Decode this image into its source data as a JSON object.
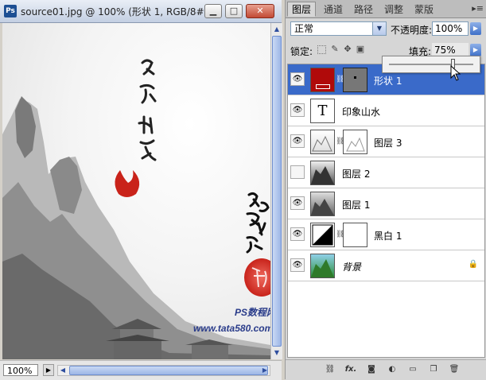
{
  "document": {
    "title": "source01.jpg @ 100% (形状 1, RGB/8#...",
    "app_icon": "Ps",
    "zoom": "100%",
    "canvas": {
      "watermark_line1": "PS数程网",
      "watermark_line2": "www.tata580.com"
    }
  },
  "window_buttons": {
    "minimize": "▁",
    "maximize": "□",
    "close": "✕"
  },
  "panel": {
    "tabs": [
      "图层",
      "通道",
      "路径",
      "调整",
      "蒙版"
    ],
    "active_tab": 0,
    "menu_glyph": "▸≡",
    "blend_mode": "正常",
    "opacity_label": "不透明度:",
    "opacity_value": "100%",
    "lock_label": "锁定:",
    "fill_label": "填充:",
    "fill_value": "75%",
    "fill_level_percent": 75,
    "layers": [
      {
        "name": "形状 1",
        "visible": true,
        "selected": true,
        "type": "shape",
        "thumb_color": "#b00a0a",
        "mask": true
      },
      {
        "name": "印象山水",
        "visible": true,
        "selected": false,
        "type": "text",
        "text_glyph": "T"
      },
      {
        "name": "图层 3",
        "visible": true,
        "selected": false,
        "type": "image",
        "mask": true
      },
      {
        "name": "图层 2",
        "visible": false,
        "selected": false,
        "type": "image"
      },
      {
        "name": "图层 1",
        "visible": true,
        "selected": false,
        "type": "image"
      },
      {
        "name": "黑白 1",
        "visible": true,
        "selected": false,
        "type": "adjustment",
        "mask": true
      },
      {
        "name": "背景",
        "visible": true,
        "selected": false,
        "type": "background",
        "locked": true
      }
    ],
    "bottom_icons": [
      "link-icon",
      "fx-icon",
      "mask-icon",
      "adjustment-icon",
      "group-icon",
      "new-layer-icon",
      "trash-icon"
    ]
  },
  "colors": {
    "selection": "#3a6ac9",
    "shape_red": "#b00a0a",
    "seal_red": "#d9342b"
  }
}
